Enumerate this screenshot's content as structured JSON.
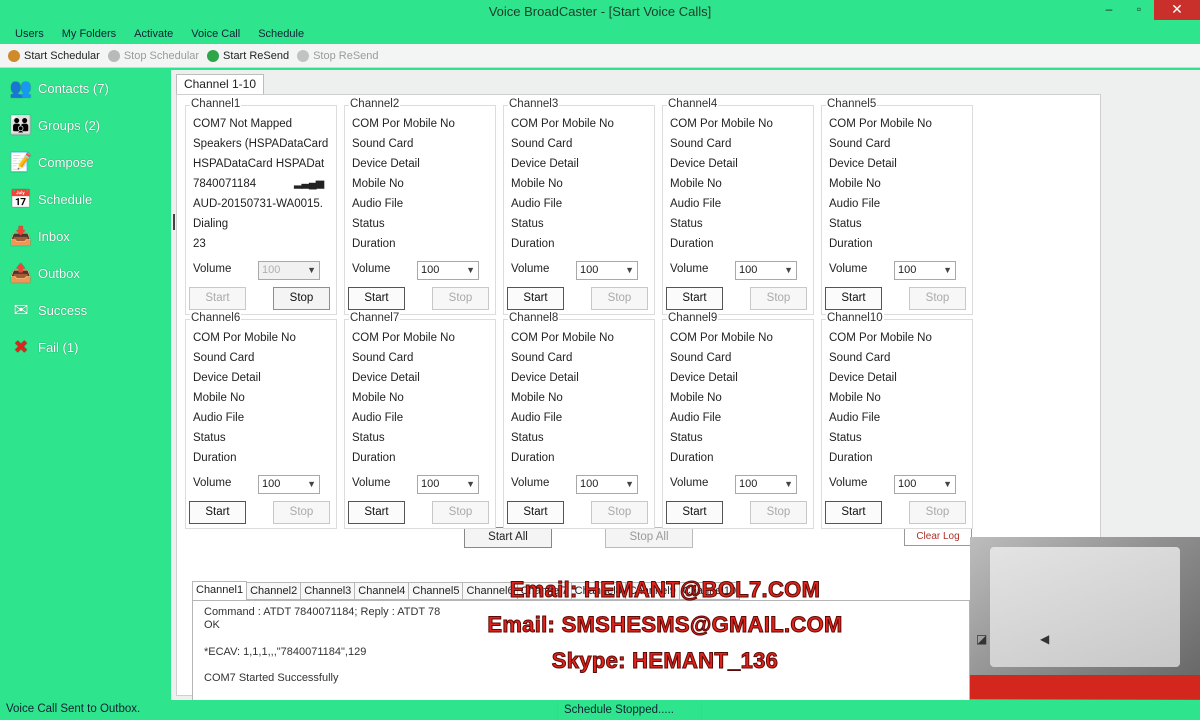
{
  "window": {
    "title": "Voice BroadCaster - [Start Voice Calls]",
    "minimize": "–",
    "maximize": "▫",
    "close": "✕"
  },
  "menu": [
    "Users",
    "My Folders",
    "Activate",
    "Voice Call",
    "Schedule"
  ],
  "toolbar": [
    {
      "label": "Start Schedular",
      "icon": "schedule-icon",
      "enabled": true,
      "color": "#d08a2c"
    },
    {
      "label": "Stop Schedular",
      "icon": "stop-schedule-icon",
      "enabled": false,
      "color": "#b9b9b9"
    },
    {
      "label": "Start ReSend",
      "icon": "resend-icon",
      "enabled": true,
      "color": "#2fa54a"
    },
    {
      "label": "Stop ReSend",
      "icon": "stop-resend-icon",
      "enabled": false,
      "color": "#c2c2c2"
    }
  ],
  "sidebar": [
    {
      "label": "Contacts (7)",
      "icon": "contacts-icon",
      "glyph": "👥"
    },
    {
      "label": "Groups (2)",
      "icon": "groups-icon",
      "glyph": "👪"
    },
    {
      "label": "Compose",
      "icon": "compose-icon",
      "glyph": "📝"
    },
    {
      "label": "Schedule",
      "icon": "schedule-icon",
      "glyph": "📅"
    },
    {
      "label": "Inbox",
      "icon": "inbox-icon",
      "glyph": "📥"
    },
    {
      "label": "Outbox",
      "icon": "outbox-icon",
      "glyph": "📤"
    },
    {
      "label": "Success",
      "icon": "success-icon",
      "glyph": "✉"
    },
    {
      "label": "Fail (1)",
      "icon": "fail-icon",
      "glyph": "✖"
    }
  ],
  "main_tab": "Channel 1-10",
  "channel1": {
    "title": "Channel1",
    "lines": [
      "COM7     Not Mapped",
      "Speakers (HSPADataCard",
      "HSPADataCard HSPADat",
      "7840071184",
      "AUD-20150731-WA0015.",
      "Dialing",
      "23"
    ],
    "signal": "▂▃▄▅",
    "volume_label": "Volume",
    "volume": "100",
    "volume_enabled": false,
    "start": "Start",
    "stop": "Stop"
  },
  "channel_defaults": {
    "lines": [
      "COM Por Mobile No",
      "Sound Card",
      "Device Detail",
      "Mobile No",
      "Audio File",
      "Status",
      "Duration"
    ],
    "volume_label": "Volume",
    "volume": "100",
    "start": "Start",
    "stop": "Stop"
  },
  "channel_titles": [
    "Channel2",
    "Channel3",
    "Channel4",
    "Channel5",
    "Channel6",
    "Channel7",
    "Channel8",
    "Channel9",
    "Channel10"
  ],
  "controls": {
    "start_all": "Start All",
    "stop_all": "Stop All",
    "clear_log": "Clear Log"
  },
  "log_tabs": [
    "Channel1",
    "Channel2",
    "Channel3",
    "Channel4",
    "Channel5",
    "Channel6",
    "Channel7",
    "Channel8",
    "Channel9",
    "Channel10"
  ],
  "log_lines": [
    "Command  : ATDT 7840071184; Reply : ATDT 78",
    "OK",
    "",
    "*ECAV: 1,1,1,,,\"7840071184\",129",
    "",
    "COM7 Started Successfully"
  ],
  "overlay": [
    "Email: HEMANT@BOL7.COM",
    "Email: SMSHESMS@GMAIL.COM",
    "Skype: HEMANT_136"
  ],
  "status": {
    "left": "Voice Call Sent to Outbox.",
    "middle": "Schedule Stopped....."
  },
  "colors": {
    "window_accent": "#2ee58e",
    "overlay_text": "#e0231b",
    "close_button": "#c9302c"
  }
}
